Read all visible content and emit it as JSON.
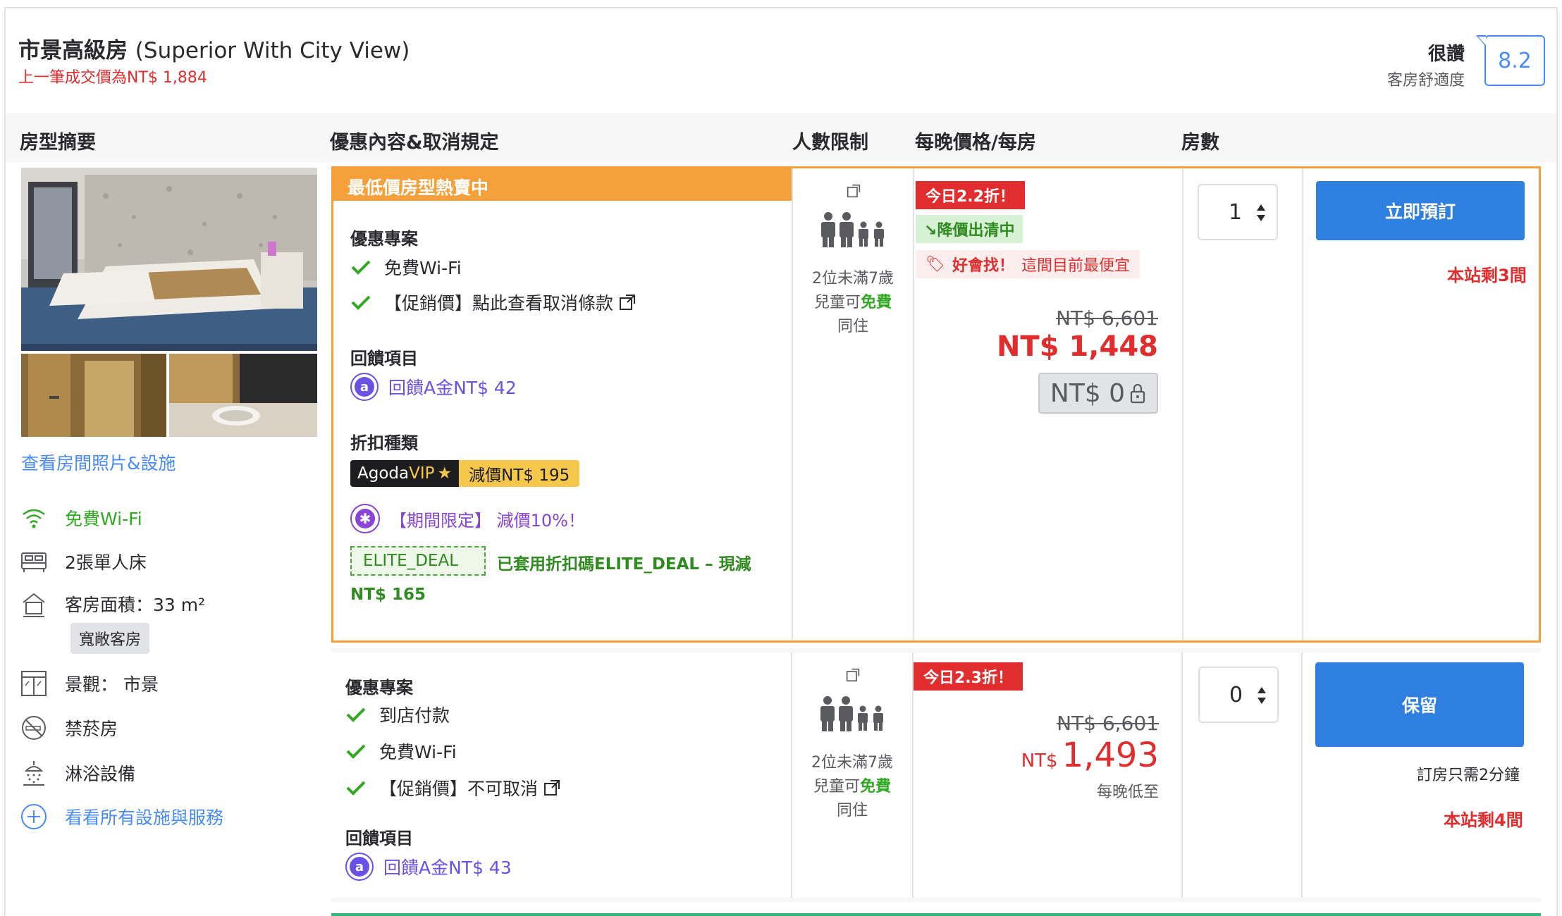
{
  "room": {
    "title": "市景高級房",
    "title_en": "(Superior With City View)",
    "last_price": "上一筆成交價為NT$ 1,884",
    "rating_word": "很讚",
    "rating_sub": "客房舒適度",
    "score": "8.2"
  },
  "columns": {
    "summary": "房型摘要",
    "offer": "優惠內容&取消規定",
    "occupancy": "人數限制",
    "price": "每晚價格/每房",
    "rooms": "房數"
  },
  "left": {
    "photos_link": "查看房間照片&設施",
    "features": {
      "wifi": "免費Wi-Fi",
      "bed": "2張單人床",
      "area": "客房面積：33 m²",
      "area_tag": "寬敞客房",
      "view": "景觀： 市景",
      "nosmoke": "禁菸房",
      "shower": "淋浴設備",
      "all": "看看所有設施與服務"
    }
  },
  "offer1": {
    "hot_label": "最低價房型熱賣中",
    "deal_title": "優惠專案",
    "benefits": [
      "免費Wi-Fi",
      "【促銷價】點此查看取消條款"
    ],
    "cashback_title": "回饋項目",
    "cashback": "回饋A金NT$ 42",
    "discount_title": "折扣種類",
    "vip_brand": "Agoda",
    "vip_word": "VIP",
    "vip_discount": "減價NT$ 195",
    "promo": "【期間限定】 減價10%！",
    "coupon_code": "ELITE_DEAL",
    "coupon_text": "已套用折扣碼ELITE_DEAL – 現減",
    "coupon_amount": "NT$ 165",
    "occupancy_line1": "2位未滿7歲",
    "occupancy_line2a": "兒童可",
    "occupancy_free": "免費",
    "occupancy_line3": "同住",
    "badge_today": "今日2.2折！",
    "badge_drop": "降價出清中",
    "badge_find_bold": "好會找！",
    "badge_find": "這間目前最便宜",
    "old_price": "NT$ 6,601",
    "new_price": "NT$ 1,448",
    "locked_price": "NT$ 0",
    "qty": "1",
    "book_label": "立即預訂",
    "rooms_left": "本站剩3間"
  },
  "offer2": {
    "deal_title": "優惠專案",
    "benefits": [
      "到店付款",
      "免費Wi-Fi",
      "【促銷價】不可取消"
    ],
    "cashback_title": "回饋項目",
    "cashback": "回饋A金NT$ 43",
    "occupancy_line1": "2位未滿7歲",
    "occupancy_line2a": "兒童可",
    "occupancy_free": "免費",
    "occupancy_line3": "同住",
    "badge_today": "今日2.3折！",
    "old_price": "NT$ 6,601",
    "currency": "NT$",
    "new_price": "1,493",
    "per_night": "每晚低至",
    "qty": "0",
    "book_label": "保留",
    "note": "訂房只需2分鐘",
    "rooms_left": "本站剩4間"
  },
  "colors": {
    "accent_blue": "#2f7fe0",
    "price_red": "#e12d2d",
    "hot_orange": "#f5a03a",
    "green": "#32a923",
    "purple": "#6a51e5"
  }
}
